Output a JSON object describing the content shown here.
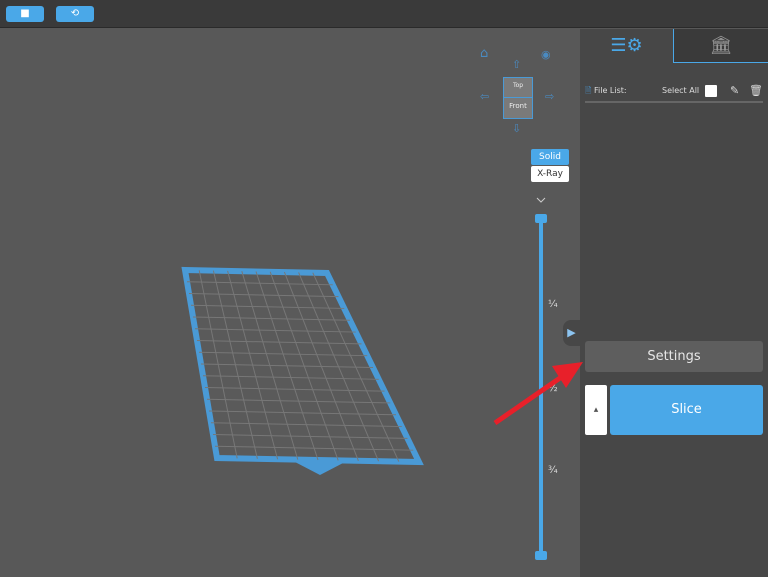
{
  "toolbar": {
    "buttons": [
      {
        "icon": "square-icon"
      },
      {
        "icon": "rotate-icon"
      }
    ]
  },
  "viewcube": {
    "top": "Top",
    "front": "Front"
  },
  "view_mode": {
    "solid": "Solid",
    "xray": "X-Ray",
    "selected": "Solid"
  },
  "layer_slider": {
    "marks": [
      "¼",
      "½",
      "¾"
    ],
    "value_top": 1.0,
    "value_bottom": 0.0
  },
  "panel": {
    "tabs": [
      {
        "icon": "settings-list-icon",
        "active": true
      },
      {
        "icon": "printer-building-icon",
        "active": false
      }
    ],
    "file_list_label": "File List:",
    "select_all_label": "Select All"
  },
  "actions": {
    "settings": "Settings",
    "slice": "Slice",
    "slice_more": "▴"
  },
  "colors": {
    "accent": "#4aa8e8",
    "annotation_arrow": "#e8202a"
  }
}
